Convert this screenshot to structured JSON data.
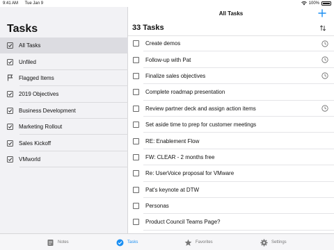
{
  "status_bar": {
    "time": "9:41 AM",
    "date": "Tue Jan 9",
    "battery": "100%"
  },
  "nav": {
    "title": "All Tasks"
  },
  "sidebar": {
    "title": "Tasks",
    "items": [
      {
        "label": "All Tasks",
        "icon": "checkbox-checked-icon",
        "selected": true
      },
      {
        "label": "Unfiled",
        "icon": "checkbox-checked-icon"
      },
      {
        "label": "Flagged Items",
        "icon": "flag-icon"
      },
      {
        "label": "2019 Objectives",
        "icon": "checkbox-checked-icon"
      },
      {
        "label": "Business Development",
        "icon": "checkbox-checked-icon"
      },
      {
        "label": "Marketing Rollout",
        "icon": "checkbox-checked-icon"
      },
      {
        "label": "Sales Kickoff",
        "icon": "checkbox-checked-icon"
      },
      {
        "label": "VMworld",
        "icon": "checkbox-checked-icon"
      }
    ]
  },
  "main": {
    "header": "33 Tasks",
    "tasks": [
      {
        "label": "Create demos",
        "reminder": true
      },
      {
        "label": "Follow-up with Pat",
        "reminder": true
      },
      {
        "label": "Finalize sales objectives",
        "reminder": true
      },
      {
        "label": "Complete roadmap presentation",
        "reminder": false
      },
      {
        "label": "Review partner deck and assign action items",
        "reminder": true
      },
      {
        "label": "Set aside time to prep for customer meetings",
        "reminder": false
      },
      {
        "label": "RE: Enablement Flow",
        "reminder": false
      },
      {
        "label": "FW: CLEAR - 2 months free",
        "reminder": false
      },
      {
        "label": "Re: UserVoice proposal for VMware",
        "reminder": false
      },
      {
        "label": "Pat's keynote at DTW",
        "reminder": false
      },
      {
        "label": "Personas",
        "reminder": false
      },
      {
        "label": "Product Council Teams Page?",
        "reminder": false
      }
    ]
  },
  "tab_bar": {
    "tabs": [
      {
        "label": "Notes",
        "icon": "notes-icon",
        "active": false
      },
      {
        "label": "Tasks",
        "icon": "tasks-checkmark-icon",
        "active": true
      },
      {
        "label": "Favorites",
        "icon": "star-icon",
        "active": false
      },
      {
        "label": "Settings",
        "icon": "gear-icon",
        "active": false
      }
    ]
  },
  "colors": {
    "accent": "#1b8ff2",
    "sidebar_bg": "#f2f2f5",
    "selected_bg": "#dcdce1"
  }
}
